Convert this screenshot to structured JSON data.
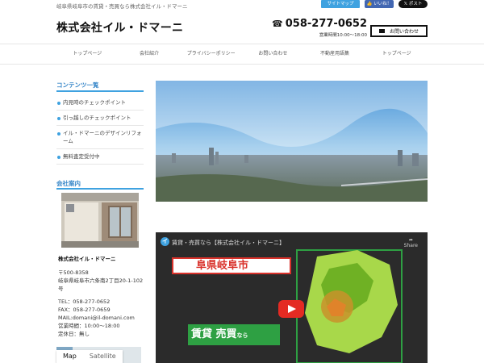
{
  "header": {
    "tagline": "岐阜県岐阜市の賃貸・売買なら株式会社イル・ドマーニ",
    "sitemap_label": "サイトマップ",
    "like_label": "👍 いいね！",
    "post_label": "𝕏 ポスト",
    "logo": "株式会社イル・ドマーニ",
    "phone": "058-277-0652",
    "hours": "営業時間10:00～18:00",
    "contact_label": "お問い合わせ"
  },
  "nav": {
    "items": [
      {
        "label": "トップページ"
      },
      {
        "label": "会社紹介"
      },
      {
        "label": "プライバシーポリシー"
      },
      {
        "label": "お問い合わせ"
      },
      {
        "label": "不動産用語集"
      },
      {
        "label": "トップページ"
      }
    ]
  },
  "sidebar": {
    "contents_title": "コンテンツ一覧",
    "contents": [
      {
        "label": "内見時のチェックポイント"
      },
      {
        "label": "引っ越しのチェックポイント"
      },
      {
        "label": "イル・ドマーニのデザインリフォーム"
      },
      {
        "label": "無料査定受付中"
      }
    ],
    "company_title": "会社案内",
    "company_name": "株式会社イル・ドマーニ",
    "postal": "〒500-8358",
    "address": "岐阜県岐阜市六条南2丁目20-1-102",
    "address_tail": "号",
    "tel": "TEL：058-277-0652",
    "fax": "FAX：058-277-0659",
    "mail": "MAIL:domani@il-domani.com",
    "hours": "営業時間：10:00～18:00",
    "holiday": "定休日：無し",
    "map_tab": "Map",
    "satellite_tab": "Satellite"
  },
  "video": {
    "logo_letter": "イ",
    "title": "賃貸・売買なら【株式会社イル・ドマーニ】",
    "share_label": "Share",
    "headline": "阜県岐阜市",
    "subline": "賃貸 売買",
    "subline_suffix": "なら"
  },
  "colors": {
    "accent": "#3fa2e0",
    "heading": "#3a88c9",
    "video_red": "#d9322b",
    "video_green": "#2ea043"
  }
}
